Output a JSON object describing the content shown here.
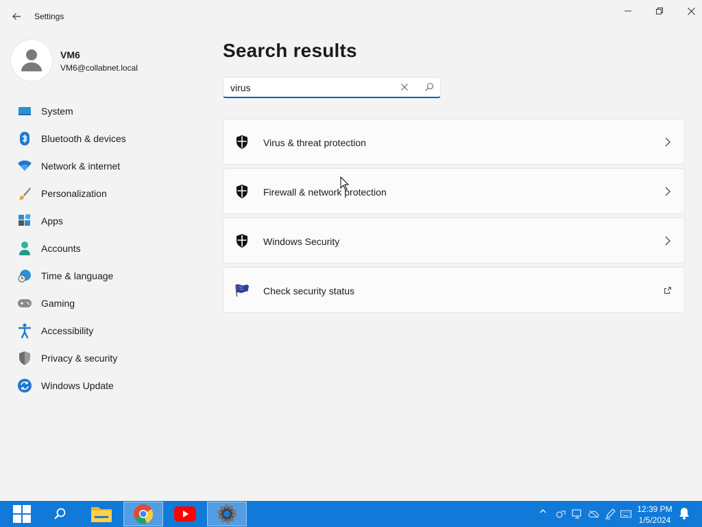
{
  "window": {
    "app_title": "Settings"
  },
  "user": {
    "name": "VM6",
    "email": "VM6@collabnet.local"
  },
  "nav": {
    "items": [
      {
        "label": "System",
        "icon": "system-icon"
      },
      {
        "label": "Bluetooth & devices",
        "icon": "bluetooth-icon"
      },
      {
        "label": "Network & internet",
        "icon": "wifi-icon"
      },
      {
        "label": "Personalization",
        "icon": "brush-icon"
      },
      {
        "label": "Apps",
        "icon": "apps-icon"
      },
      {
        "label": "Accounts",
        "icon": "accounts-icon"
      },
      {
        "label": "Time & language",
        "icon": "globe-clock-icon"
      },
      {
        "label": "Gaming",
        "icon": "gamepad-icon"
      },
      {
        "label": "Accessibility",
        "icon": "accessibility-icon"
      },
      {
        "label": "Privacy & security",
        "icon": "shield-icon"
      },
      {
        "label": "Windows Update",
        "icon": "update-icon"
      }
    ]
  },
  "main": {
    "title": "Search results",
    "search": {
      "value": "virus"
    },
    "results": [
      {
        "label": "Virus & threat protection",
        "icon": "shield-icon",
        "action": "chevron-right-icon"
      },
      {
        "label": "Firewall & network protection",
        "icon": "shield-icon",
        "action": "chevron-right-icon"
      },
      {
        "label": "Windows Security",
        "icon": "shield-icon",
        "action": "chevron-right-icon"
      },
      {
        "label": "Check security status",
        "icon": "flag-icon",
        "action": "external-link-icon"
      }
    ]
  },
  "taskbar": {
    "clock_time": "12:39 PM",
    "clock_date": "1/5/2024"
  },
  "colors": {
    "accent": "#005fb8",
    "taskbar": "#1179d8",
    "background": "#f3f3f3"
  }
}
